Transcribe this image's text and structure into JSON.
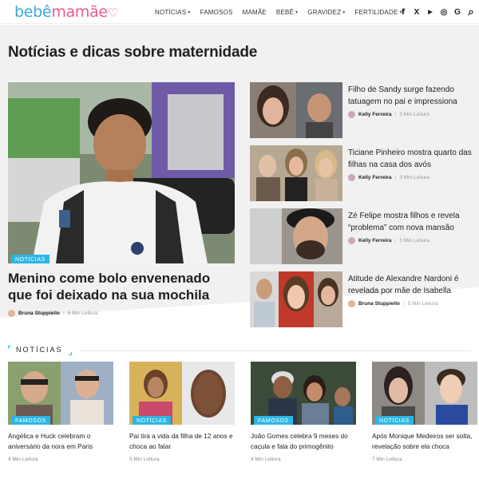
{
  "header": {
    "logo_part1": "bebê",
    "logo_part2": "mamãe",
    "nav": [
      {
        "label": "NOTÍCIAS",
        "has_dropdown": true
      },
      {
        "label": "FAMOSOS",
        "has_dropdown": false
      },
      {
        "label": "MAMÃE",
        "has_dropdown": false
      },
      {
        "label": "BEBÊ",
        "has_dropdown": true
      },
      {
        "label": "GRAVIDEZ",
        "has_dropdown": true
      },
      {
        "label": "FERTILIDADE",
        "has_dropdown": true
      }
    ],
    "social": {
      "facebook": "f",
      "x": "X",
      "youtube": "▶",
      "instagram": "◎",
      "google": "G",
      "search": "⌕"
    }
  },
  "page_title": "Notícias e dicas sobre maternidade",
  "hero": {
    "category": "NOTÍCIAS",
    "title": "Menino come bolo envenenado que foi deixado na sua mochila",
    "author": "Bruna Stuppiello",
    "read_time": "6 Min Leitura"
  },
  "side_articles": [
    {
      "title": "Filho de Sandy surge fazendo tatuagem no pai e impressiona",
      "author": "Kelly Ferreira",
      "read_time": "3 Min Leitura"
    },
    {
      "title": "Ticiane Pinheiro mostra quarto das filhas na casa dos avós",
      "author": "Kelly Ferreira",
      "read_time": "3 Min Leitura"
    },
    {
      "title": "Zé Felipe mostra filhos e revela “problema” com nova mansão",
      "author": "Kelly Ferreira",
      "read_time": "3 Min Leitura"
    },
    {
      "title": "Atitude de Alexandre Nardoni é revelada por mãe de Isabella",
      "author": "Bruna Stuppiello",
      "read_time": "5 Min Leitura"
    }
  ],
  "section": {
    "label": "NOTÍCIAS"
  },
  "cards": [
    {
      "category": "FAMOSOS",
      "title": "Angélica e Huck celebram o aniversário da nora em Paris",
      "read_time": "4 Min Leitura"
    },
    {
      "category": "NOTÍCIAS",
      "title": "Pai tira a vida da filha de 12 anos e choca ao falar",
      "read_time": "5 Min Leitura"
    },
    {
      "category": "FAMOSOS",
      "title": "João Gomes celebra 9 meses do caçula e fala do primogênito",
      "read_time": "4 Min Leitura"
    },
    {
      "category": "NOTÍCIAS",
      "title": "Após Monique Medeiros ser solta, revelação sobre ela choca",
      "read_time": "7 Min Leitura"
    }
  ],
  "colors": {
    "accent": "#2cb6e3",
    "logo_blue": "#3aa6e0",
    "logo_pink": "#ee5a8c"
  }
}
